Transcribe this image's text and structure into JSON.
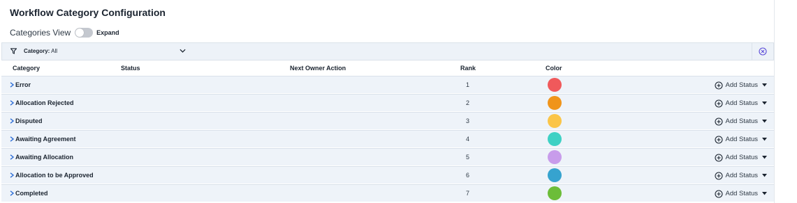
{
  "page": {
    "title": "Workflow Category Configuration"
  },
  "view": {
    "label": "Categories View",
    "toggle_label": "Expand",
    "toggle_on": false
  },
  "filter": {
    "label": "Category:",
    "value": "All"
  },
  "table": {
    "headers": {
      "category": "Category",
      "status": "Status",
      "next_owner_action": "Next Owner Action",
      "rank": "Rank",
      "color": "Color"
    },
    "rows": [
      {
        "category": "Error",
        "rank": "1",
        "color": "#f0595b"
      },
      {
        "category": "Allocation Rejected",
        "rank": "2",
        "color": "#f0941a"
      },
      {
        "category": "Disputed",
        "rank": "3",
        "color": "#fbc548"
      },
      {
        "category": "Awaiting Agreement",
        "rank": "4",
        "color": "#3ed1c4"
      },
      {
        "category": "Awaiting Allocation",
        "rank": "5",
        "color": "#c89ceb"
      },
      {
        "category": "Allocation to be Approved",
        "rank": "6",
        "color": "#36a3cf"
      },
      {
        "category": "Completed",
        "rank": "7",
        "color": "#6cbd39"
      }
    ],
    "add_status_label": "Add Status"
  },
  "icons": {
    "filter": "filter-funnel-icon",
    "dropdown": "chevron-down-icon",
    "clear": "clear-circle-x-icon",
    "expand": "chevron-right-icon",
    "add": "plus-circle-icon",
    "caret": "caret-down-icon"
  },
  "colors": {
    "accent": "#2f6fd6",
    "clear_icon": "#5b4bd8"
  }
}
